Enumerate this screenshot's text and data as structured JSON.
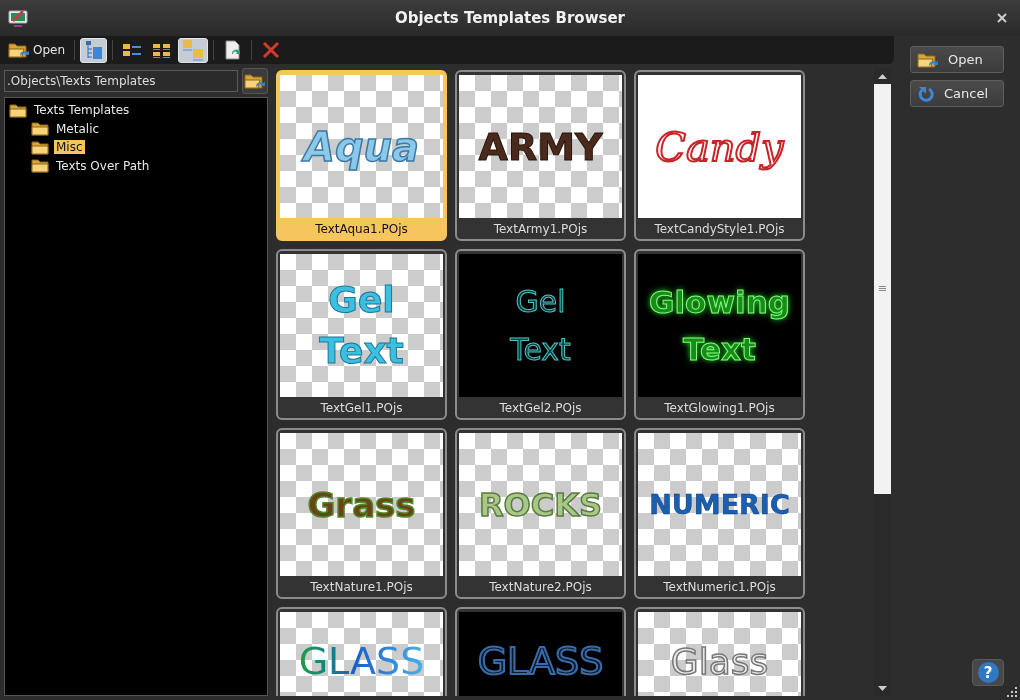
{
  "window": {
    "title": "Objects Templates Browser"
  },
  "toolbar": {
    "open_label": "Open",
    "buttons": [
      {
        "kind": "tree",
        "selected": true
      },
      {
        "kind": "list",
        "selected": false
      },
      {
        "kind": "grid",
        "selected": false
      },
      {
        "kind": "thumbs",
        "selected": true
      },
      {
        "kind": "refresh",
        "selected": false
      },
      {
        "kind": "delete",
        "selected": false
      }
    ]
  },
  "path": {
    "value": ".Objects\\Texts Templates"
  },
  "tree": [
    {
      "label": "Texts Templates",
      "selected": false,
      "children": [
        {
          "label": "Metalic",
          "selected": false
        },
        {
          "label": "Misc",
          "selected": true
        },
        {
          "label": "Texts Over Path",
          "selected": false
        }
      ]
    }
  ],
  "tiles": [
    {
      "name": "TextAqua1.POjs",
      "preview": "Aqua",
      "kind": "aqua",
      "selected": true
    },
    {
      "name": "TextArmy1.POjs",
      "preview": "ARMY",
      "kind": "army",
      "selected": false
    },
    {
      "name": "TextCandyStyle1.POjs",
      "preview": "Candy",
      "kind": "candy",
      "selected": false
    },
    {
      "name": "TextGel1.POjs",
      "preview": "Gel\nText",
      "kind": "gel",
      "selected": false
    },
    {
      "name": "TextGel2.POjs",
      "preview": "Gel\nText",
      "kind": "gel-outline",
      "selected": false
    },
    {
      "name": "TextGlowing1.POjs",
      "preview": "Glowing\nText",
      "kind": "glow",
      "selected": false
    },
    {
      "name": "TextNature1.POjs",
      "preview": "Grass",
      "kind": "grass",
      "selected": false
    },
    {
      "name": "TextNature2.POjs",
      "preview": "ROCKS",
      "kind": "rocks",
      "selected": false
    },
    {
      "name": "TextNumeric1.POjs",
      "preview": "NUMERIC",
      "kind": "numeric",
      "selected": false
    },
    {
      "preview": "GLASS",
      "kind": "glass",
      "selected": false
    },
    {
      "preview": "GLASS",
      "kind": "glass-outline",
      "selected": false
    },
    {
      "preview": "Glass",
      "kind": "glass-grey",
      "selected": false
    }
  ],
  "buttons": [
    {
      "kind": "open",
      "label": "Open"
    },
    {
      "kind": "cancel",
      "label": "Cancel"
    }
  ],
  "help": "?"
}
